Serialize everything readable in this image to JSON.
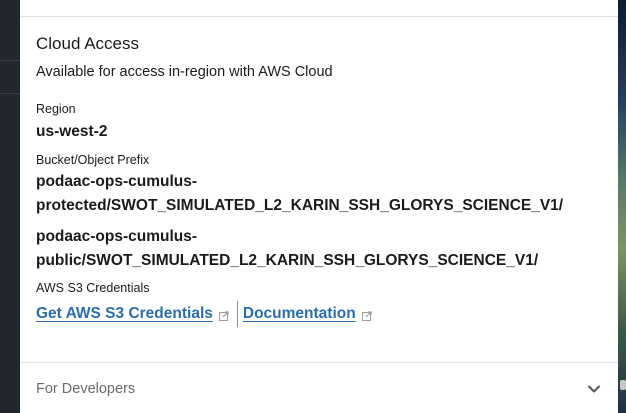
{
  "cloud_access": {
    "title": "Cloud Access",
    "subtitle": "Available for access in-region with AWS Cloud",
    "region_label": "Region",
    "region_value": "us-west-2",
    "bucket_label": "Bucket/Object Prefix",
    "buckets": [
      {
        "line1": "podaac-ops-cumulus-",
        "line2": "protected/SWOT_SIMULATED_L2_KARIN_SSH_GLORYS_SCIENCE_V1/"
      },
      {
        "line1": "podaac-ops-cumulus-",
        "line2": "public/SWOT_SIMULATED_L2_KARIN_SSH_GLORYS_SCIENCE_V1/"
      }
    ],
    "credentials_label": "AWS S3 Credentials",
    "links": {
      "credentials": "Get AWS S3 Credentials",
      "documentation": "Documentation"
    }
  },
  "developers": {
    "label": "For Developers"
  },
  "colors": {
    "link": "#2b6cab",
    "text": "#1b1b1b",
    "muted": "#6b6b6b",
    "divider": "#e1e1e1"
  },
  "icons": {
    "external_link": "external-link-icon",
    "expand": "chevron-down-icon"
  }
}
